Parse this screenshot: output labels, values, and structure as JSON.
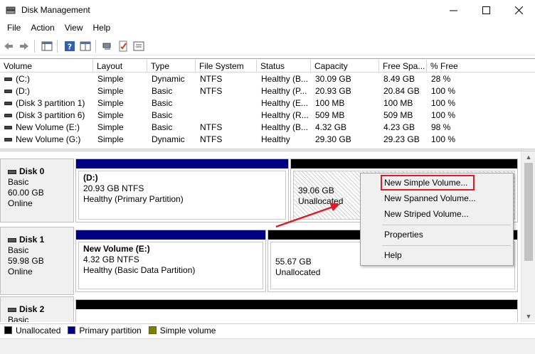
{
  "window": {
    "title": "Disk Management"
  },
  "menu": [
    "File",
    "Action",
    "View",
    "Help"
  ],
  "columns": [
    "Volume",
    "Layout",
    "Type",
    "File System",
    "Status",
    "Capacity",
    "Free Spa...",
    "% Free"
  ],
  "volumes": [
    [
      "(C:)",
      "Simple",
      "Dynamic",
      "NTFS",
      "Healthy (B...",
      "30.09 GB",
      "8.49 GB",
      "28 %"
    ],
    [
      "(D:)",
      "Simple",
      "Basic",
      "NTFS",
      "Healthy (P...",
      "20.93 GB",
      "20.84 GB",
      "100 %"
    ],
    [
      "(Disk 3 partition 1)",
      "Simple",
      "Basic",
      "",
      "Healthy (E...",
      "100 MB",
      "100 MB",
      "100 %"
    ],
    [
      "(Disk 3 partition 6)",
      "Simple",
      "Basic",
      "",
      "Healthy (R...",
      "509 MB",
      "509 MB",
      "100 %"
    ],
    [
      "New Volume (E:)",
      "Simple",
      "Basic",
      "NTFS",
      "Healthy (B...",
      "4.32 GB",
      "4.23 GB",
      "98 %"
    ],
    [
      "New Volume (G:)",
      "Simple",
      "Dynamic",
      "NTFS",
      "Healthy",
      "29.30 GB",
      "29.23 GB",
      "100 %"
    ]
  ],
  "disks": [
    {
      "name": "Disk 0",
      "type": "Basic",
      "size": "60.00 GB",
      "state": "Online",
      "partitions": [
        {
          "title": "(D:)",
          "line1": "20.93 GB NTFS",
          "line2": "Healthy (Primary Partition)"
        },
        {
          "title": "",
          "line1": "39.06 GB",
          "line2": "Unallocated"
        }
      ]
    },
    {
      "name": "Disk 1",
      "type": "Basic",
      "size": "59.98 GB",
      "state": "Online",
      "partitions": [
        {
          "title": "New Volume  (E:)",
          "line1": "4.32 GB NTFS",
          "line2": "Healthy (Basic Data Partition)"
        },
        {
          "title": "",
          "line1": "55.67 GB",
          "line2": "Unallocated"
        }
      ]
    },
    {
      "name": "Disk 2",
      "type": "Basic"
    }
  ],
  "context_menu": {
    "items": [
      "New Simple Volume...",
      "New Spanned Volume...",
      "New Striped Volume...",
      "Properties",
      "Help"
    ]
  },
  "legend": [
    {
      "label": "Unallocated",
      "color": "#000000"
    },
    {
      "label": "Primary partition",
      "color": "#000080"
    },
    {
      "label": "Simple volume",
      "color": "#808000"
    }
  ],
  "colors": {
    "primary": "#000080",
    "unallocated": "#000000",
    "highlight": "#e01b24"
  }
}
